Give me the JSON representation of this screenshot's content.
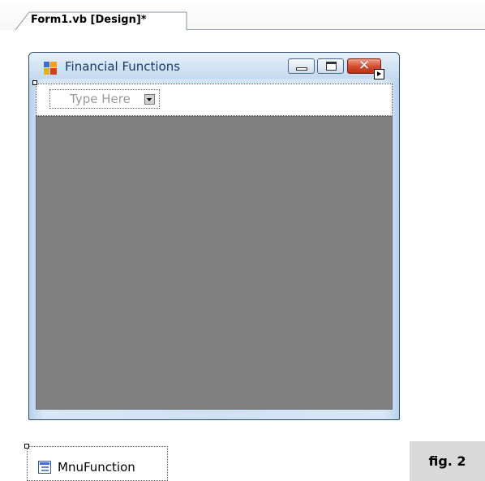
{
  "tab": {
    "label": "Form1.vb [Design]*"
  },
  "form": {
    "title": "Financial Functions",
    "close_glyph": "✕",
    "menu": {
      "placeholder_item": "Type Here"
    },
    "icon": "form-app-icon"
  },
  "tray": {
    "component_name": "MnuFunction",
    "icon": "menustrip-icon"
  },
  "figure": {
    "caption": "fig. 2"
  },
  "colors": {
    "client_area": "#808080",
    "close_button": "#d24a2e",
    "title_text": "#1a3a66",
    "caption_bg": "#d9d9d9"
  }
}
